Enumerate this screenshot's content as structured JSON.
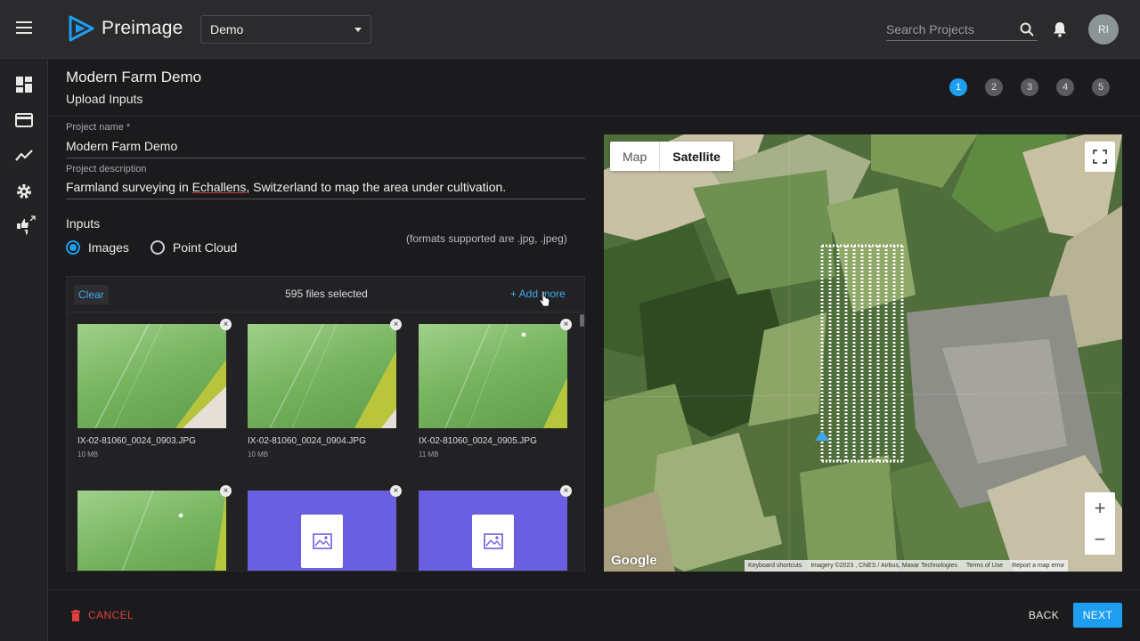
{
  "app": {
    "name": "Preimage"
  },
  "header": {
    "project_select": "Demo",
    "search_placeholder": "Search Projects",
    "avatar_initials": "RI"
  },
  "page": {
    "title": "Modern Farm Demo",
    "subtitle": "Upload Inputs",
    "steps": [
      "1",
      "2",
      "3",
      "4",
      "5"
    ],
    "active_step": 1
  },
  "form": {
    "name_label": "Project name *",
    "name_value": "Modern Farm Demo",
    "desc_label": "Project description",
    "desc_before": "Farmland surveying in ",
    "desc_misspelled": "Echallens",
    "desc_after": ", Switzerland to map the area under cultivation.",
    "inputs_label": "Inputs",
    "radio_images": "Images",
    "radio_pointcloud": "Point Cloud",
    "selected_input": "Images",
    "formats_note": "(formats supported are .jpg, .jpeg)"
  },
  "files": {
    "clear_label": "Clear",
    "count_label": "595 files selected",
    "add_more_label": "+ Add more",
    "items": [
      {
        "name": "IX-02-81060_0024_0903.JPG",
        "size": "10 MB"
      },
      {
        "name": "IX-02-81060_0024_0904.JPG",
        "size": "10 MB"
      },
      {
        "name": "IX-02-81060_0024_0905.JPG",
        "size": "11 MB"
      }
    ]
  },
  "map": {
    "tab_map": "Map",
    "tab_satellite": "Satellite",
    "active_tab": "Satellite",
    "logo": "Google",
    "attribution": [
      "Keyboard shortcuts",
      "Imagery ©2023 , CNES / Airbus, Maxar Technologies",
      "Terms of Use",
      "Report a map error"
    ]
  },
  "footer": {
    "cancel_label": "CANCEL",
    "back_label": "BACK",
    "next_label": "NEXT"
  },
  "colors": {
    "accent": "#1e9ef0",
    "danger": "#e04040",
    "background": "#1b1b1d",
    "topbar": "#2b2b2e"
  }
}
